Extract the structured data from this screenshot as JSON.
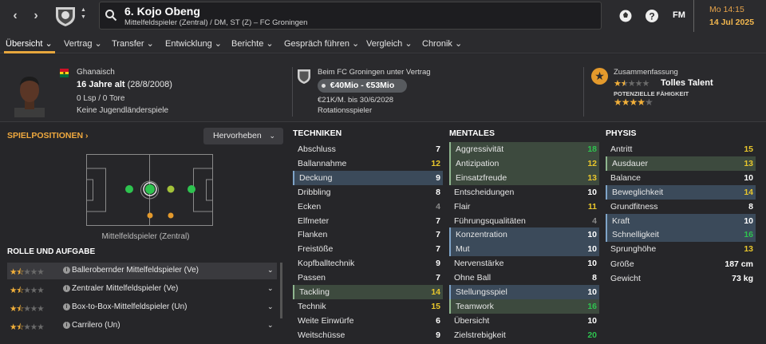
{
  "header": {
    "player_title": "6. Kojo Obeng",
    "subtitle": "Mittelfeldspieler (Zentral) / DM, ST (Z) – FC Groningen",
    "fm_label": "FM",
    "time": "Mo 14:15",
    "date": "14 Jul 2025"
  },
  "menu": [
    "Übersicht",
    "Vertrag",
    "Transfer",
    "Entwicklung",
    "Berichte",
    "Gespräch führen",
    "Vergleich",
    "Chronik"
  ],
  "profile": {
    "nationality": "Ghanaisch",
    "age_bold": "16 Jahre alt",
    "birth": "(28/8/2008)",
    "caps": "0 Lsp / 0 Tore",
    "youth": "Keine Jugendländerspiele"
  },
  "contract": {
    "label": "Beim FC Groningen unter Vertrag",
    "value": "€40Mio - €53Mio",
    "wage": "€21K/M. bis 30/6/2028",
    "status": "Rotationsspieler"
  },
  "summary": {
    "label": "Zusammenfassung",
    "current_stars": 1.5,
    "talent": "Tolles Talent",
    "potential_label": "POTENZIELLE FÄHIGKEIT",
    "potential_stars": 4
  },
  "positions": {
    "title": "SPIELPOSITIONEN",
    "highlight_label": "Hervorheben",
    "caption": "Mittelfeldspieler (Zentral)"
  },
  "roles": {
    "title": "ROLLE UND AUFGABE",
    "items": [
      {
        "label": "Ballerobernder Mittelfeldspieler (Ve)",
        "stars": 1.5
      },
      {
        "label": "Zentraler Mittelfeldspieler (Ve)",
        "stars": 1.5
      },
      {
        "label": "Box-to-Box-Mittelfeldspieler (Un)",
        "stars": 1.5
      },
      {
        "label": "Carrilero (Un)",
        "stars": 1.5
      }
    ]
  },
  "colors": {
    "accent": "#e7a63d",
    "green": "#2ec34f",
    "yellow": "#e8c62c",
    "white": "#ffffff",
    "grey": "#8a8a8a"
  },
  "techniken": {
    "title": "TECHNIKEN",
    "items": [
      {
        "name": "Abschluss",
        "value": "7"
      },
      {
        "name": "Ballannahme",
        "value": "12"
      },
      {
        "name": "Deckung",
        "value": "9"
      },
      {
        "name": "Dribbling",
        "value": "8"
      },
      {
        "name": "Ecken",
        "value": "4"
      },
      {
        "name": "Elfmeter",
        "value": "7"
      },
      {
        "name": "Flanken",
        "value": "7"
      },
      {
        "name": "Freistöße",
        "value": "7"
      },
      {
        "name": "Kopfballtechnik",
        "value": "9"
      },
      {
        "name": "Passen",
        "value": "7"
      },
      {
        "name": "Tackling",
        "value": "14"
      },
      {
        "name": "Technik",
        "value": "15"
      },
      {
        "name": "Weite Einwürfe",
        "value": "6"
      },
      {
        "name": "Weitschüsse",
        "value": "9"
      }
    ]
  },
  "mentales": {
    "title": "MENTALES",
    "items": [
      {
        "name": "Aggressivität",
        "value": "18"
      },
      {
        "name": "Antizipation",
        "value": "12"
      },
      {
        "name": "Einsatzfreude",
        "value": "13"
      },
      {
        "name": "Entscheidungen",
        "value": "10"
      },
      {
        "name": "Flair",
        "value": "11"
      },
      {
        "name": "Führungsqualitäten",
        "value": "4"
      },
      {
        "name": "Konzentration",
        "value": "10"
      },
      {
        "name": "Mut",
        "value": "10"
      },
      {
        "name": "Nervenstärke",
        "value": "10"
      },
      {
        "name": "Ohne Ball",
        "value": "8"
      },
      {
        "name": "Stellungsspiel",
        "value": "10"
      },
      {
        "name": "Teamwork",
        "value": "16"
      },
      {
        "name": "Übersicht",
        "value": "10"
      },
      {
        "name": "Zielstrebigkeit",
        "value": "20"
      }
    ]
  },
  "physis": {
    "title": "PHYSIS",
    "items": [
      {
        "name": "Antritt",
        "value": "15"
      },
      {
        "name": "Ausdauer",
        "value": "13"
      },
      {
        "name": "Balance",
        "value": "10"
      },
      {
        "name": "Beweglichkeit",
        "value": "14"
      },
      {
        "name": "Grundfitness",
        "value": "8"
      },
      {
        "name": "Kraft",
        "value": "10"
      },
      {
        "name": "Schnelligkeit",
        "value": "16"
      },
      {
        "name": "Sprunghöhe",
        "value": "13"
      }
    ],
    "extra": [
      {
        "name": "Größe",
        "value": "187 cm"
      },
      {
        "name": "Gewicht",
        "value": "73 kg"
      }
    ]
  }
}
